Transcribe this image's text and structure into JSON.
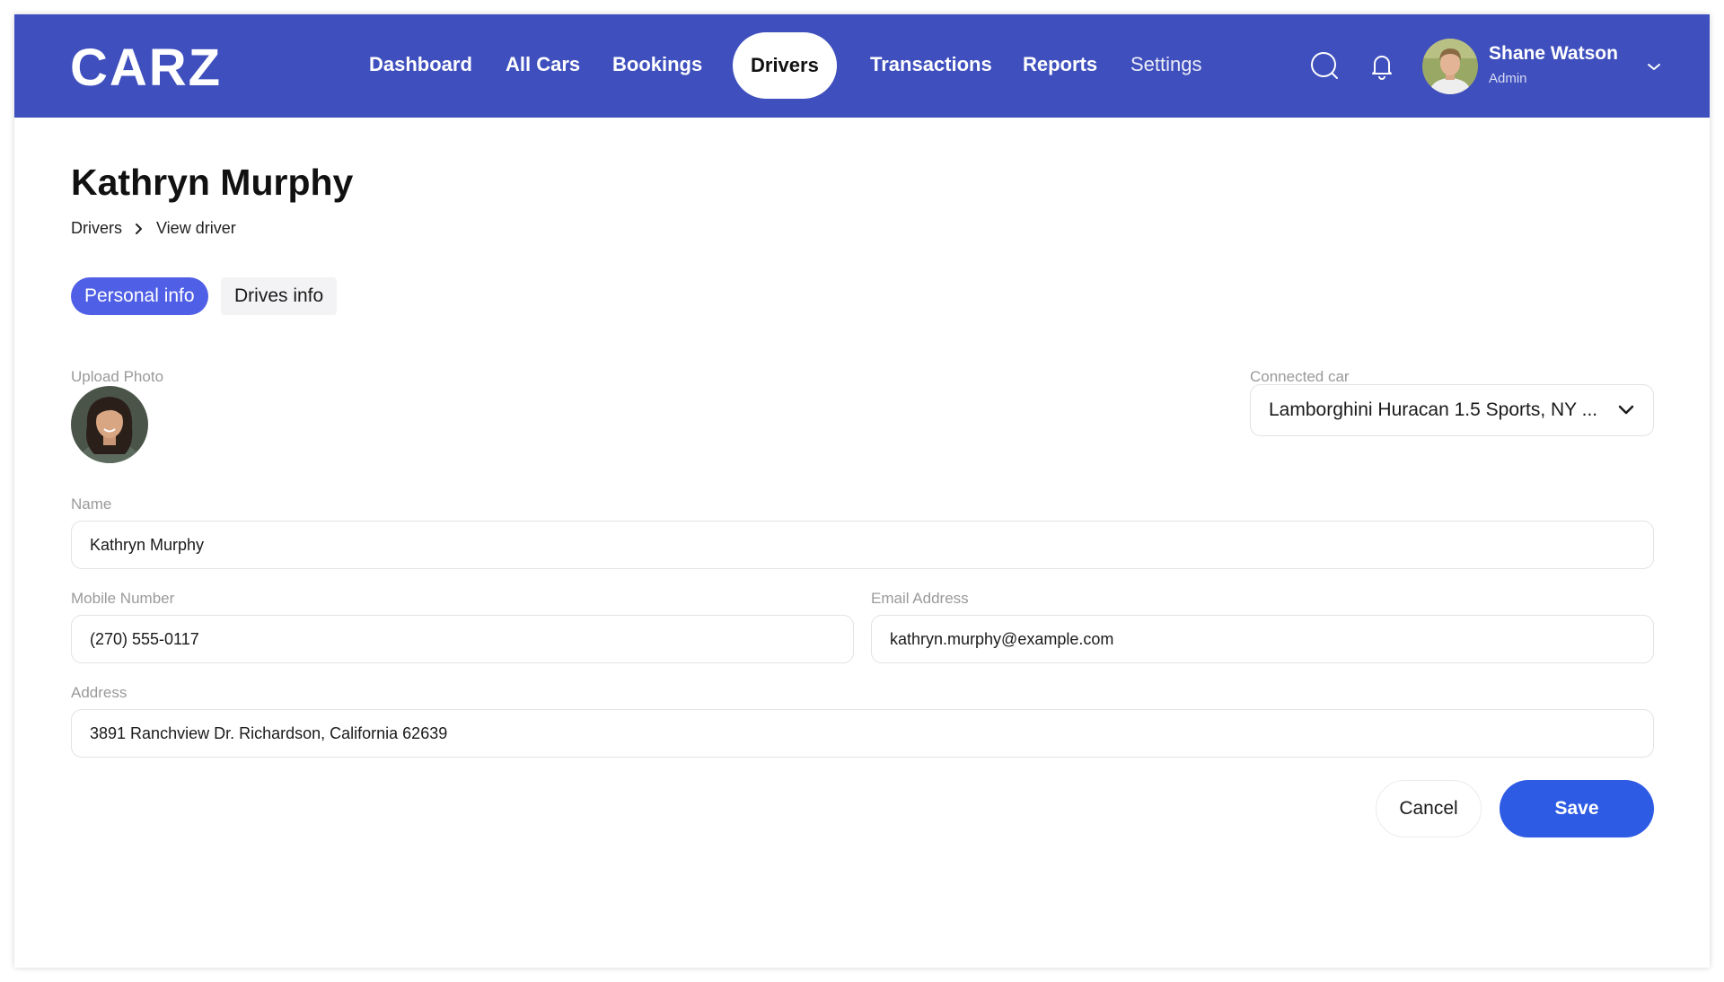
{
  "header": {
    "logo_text": "CARZ",
    "nav": [
      {
        "label": "Dashboard"
      },
      {
        "label": "All Cars"
      },
      {
        "label": "Bookings"
      },
      {
        "label": "Drivers"
      },
      {
        "label": "Transactions"
      },
      {
        "label": "Reports"
      },
      {
        "label": "Settings"
      }
    ],
    "active_nav": "Drivers",
    "icons": [
      "search-icon",
      "bell-icon",
      "chevron-down-icon"
    ],
    "user": {
      "name": "Shane Watson",
      "role": "Admin"
    }
  },
  "page": {
    "title": "Kathryn Murphy",
    "breadcrumb": {
      "parent": "Drivers",
      "current": "View driver"
    }
  },
  "tabs": [
    {
      "label": "Personal info",
      "active": true
    },
    {
      "label": "Drives info",
      "active": false
    }
  ],
  "form": {
    "upload_photo_label": "Upload Photo",
    "connected_car": {
      "label": "Connected car",
      "value": "Lamborghini Huracan 1.5 Sports, NY ..."
    },
    "name": {
      "label": "Name",
      "value": "Kathryn Murphy"
    },
    "mobile": {
      "label": "Mobile Number",
      "value": "(270) 555-0117"
    },
    "email": {
      "label": "Email Address",
      "value": "kathryn.murphy@example.com"
    },
    "address": {
      "label": "Address",
      "value": "3891 Ranchview Dr. Richardson, California 62639"
    }
  },
  "actions": {
    "cancel_label": "Cancel",
    "save_label": "Save"
  },
  "colors": {
    "header_bg": "#3f4fbd",
    "active_tab": "#4f5fe6",
    "save_button": "#2d5be3"
  }
}
